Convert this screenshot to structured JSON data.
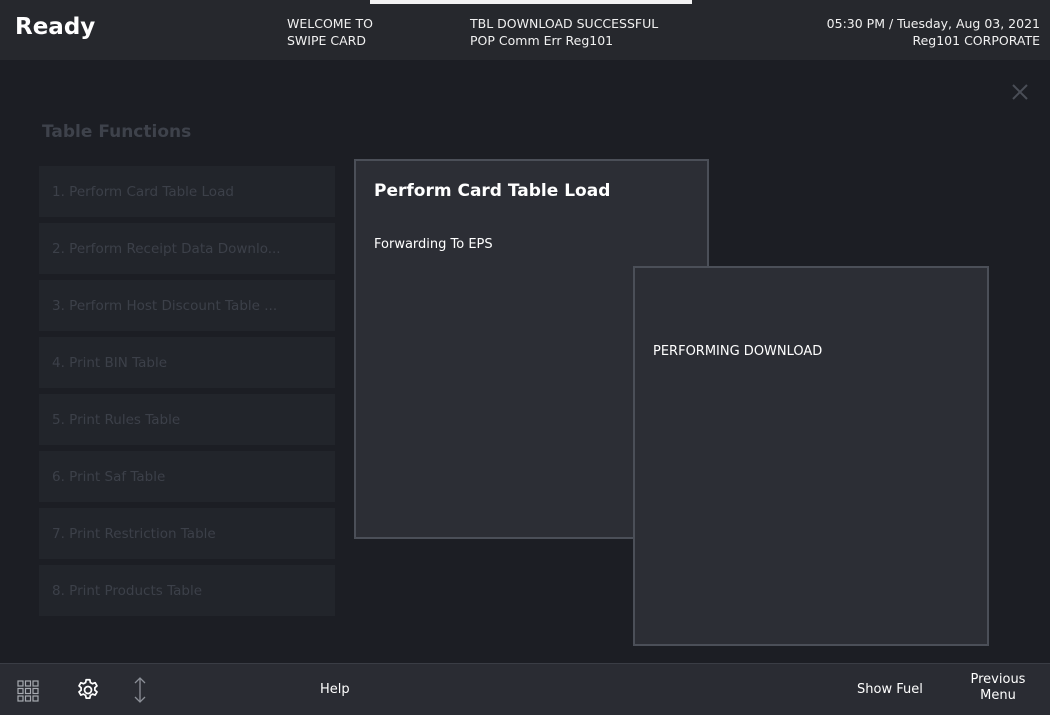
{
  "header": {
    "status": "Ready",
    "msg1_line1": "WELCOME TO",
    "msg1_line2": "SWIPE CARD",
    "msg2_line1": "TBL DOWNLOAD SUCCESSFUL",
    "msg2_line2": "POP Comm Err Reg101",
    "datetime": "05:30 PM / Tuesday, Aug 03, 2021",
    "register": "Reg101  CORPORATE"
  },
  "table_functions": {
    "title": "Table Functions",
    "items": [
      {
        "label": "1. Perform Card Table Load"
      },
      {
        "label": "2. Perform Receipt Data Downlo..."
      },
      {
        "label": "3. Perform Host Discount Table ..."
      },
      {
        "label": "4. Print BIN Table"
      },
      {
        "label": "5. Print Rules Table"
      },
      {
        "label": "6. Print Saf Table"
      },
      {
        "label": "7. Print Restriction Table"
      },
      {
        "label": "8. Print Products Table"
      }
    ]
  },
  "dialog1": {
    "title": "Perform Card Table Load",
    "text": "Forwarding To EPS"
  },
  "dialog2": {
    "text": "PERFORMING DOWNLOAD"
  },
  "footer": {
    "help": "Help",
    "show_fuel": "Show Fuel",
    "previous_line1": "Previous",
    "previous_line2": "Menu"
  },
  "icons": {
    "grid": "grid-icon",
    "settings": "gear-icon",
    "resize": "resize-vertical-icon",
    "close": "close-icon"
  }
}
